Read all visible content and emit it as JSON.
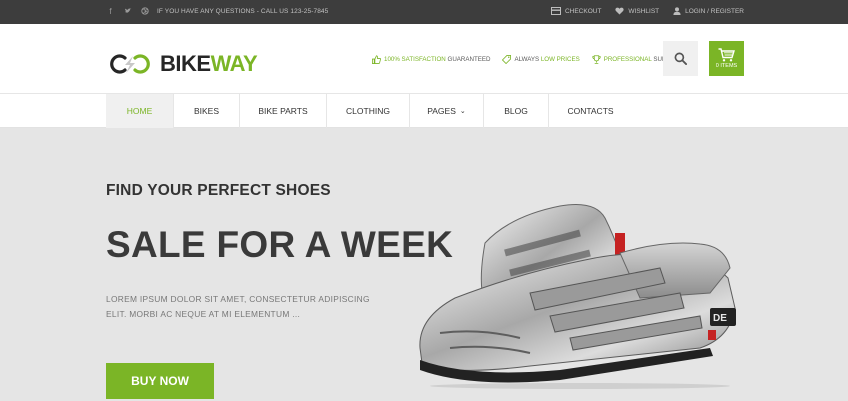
{
  "topbar": {
    "social_icons": [
      "facebook-icon",
      "twitter-icon",
      "dribbble-icon"
    ],
    "contact_text": "IF YOU HAVE ANY QUESTIONS - CALL US 123-25-7845",
    "checkout_label": "CHECKOUT",
    "wishlist_label": "WISHLIST",
    "login_label": "LOGIN / REGISTER"
  },
  "header": {
    "logo_text_dark": "BIKE",
    "logo_text_accent": "WAY",
    "features": [
      {
        "icon": "thumbs-up-icon",
        "accent": "100% SATISFACTION",
        "text": " GUARANTEED"
      },
      {
        "icon": "tag-icon",
        "text": "ALWAYS ",
        "accent": "LOW PRICES"
      },
      {
        "icon": "trophy-icon",
        "accent": "PROFESSIONAL",
        "text": " SUPPORT"
      }
    ],
    "cart_count": "0 ITEMS"
  },
  "nav": {
    "items": [
      {
        "label": "HOME"
      },
      {
        "label": "BIKES"
      },
      {
        "label": "BIKE PARTS"
      },
      {
        "label": "CLOTHING"
      },
      {
        "label": "PAGES"
      },
      {
        "label": "BLOG"
      },
      {
        "label": "CONTACTS"
      }
    ]
  },
  "hero": {
    "kicker": "FIND YOUR PERFECT SHOES",
    "headline": "SALE FOR A WEEK",
    "body": "LOREM IPSUM DOLOR SIT AMET, CONSECTETUR ADIPISCING ELIT. MORBI AC NEQUE AT MI ELEMENTUM ...",
    "button_label": "BUY NOW",
    "shoe_brand": "DE"
  },
  "colors": {
    "accent": "#7bb526",
    "topbar_bg": "#3d3d3d",
    "hero_bg": "#e5e5e5"
  }
}
